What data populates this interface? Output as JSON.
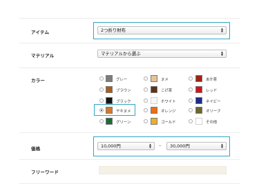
{
  "form": {
    "item": {
      "label": "アイテム",
      "value": "2つ折り財布",
      "arrows": "▲▼"
    },
    "material": {
      "label": "マテリアル",
      "value": "マテリアルから選ぶ",
      "arrows": "▲▼"
    },
    "color": {
      "label": "カラー",
      "selected": "ヤキヌメ",
      "options": [
        {
          "name": "グレー",
          "color": "#7d7d7d",
          "checked": false
        },
        {
          "name": "ブラウン",
          "color": "#a85d1c",
          "checked": false
        },
        {
          "name": "ブラック",
          "color": "#141414",
          "checked": false
        },
        {
          "name": "ヤキヌメ",
          "color": "#d6782a",
          "checked": true
        },
        {
          "name": "グリーン",
          "color": "#1d6b3a",
          "checked": false
        },
        {
          "name": "ヌメ",
          "color": "#e9c396",
          "checked": false
        },
        {
          "name": "こげ茶",
          "color": "#5d3415",
          "checked": false
        },
        {
          "name": "ホワイト",
          "color": "#f7f7f7",
          "checked": false
        },
        {
          "name": "オレンジ",
          "color": "#ee6d12",
          "checked": false
        },
        {
          "name": "ゴールド",
          "color": "#e8b12a",
          "checked": false
        },
        {
          "name": "あか茶",
          "color": "#9c2412",
          "checked": false
        },
        {
          "name": "レッド",
          "color": "#d7101a",
          "checked": false
        },
        {
          "name": "ネイビー",
          "color": "#1d2a88",
          "checked": false
        },
        {
          "name": "オリーブ",
          "color": "#6c6631",
          "checked": false
        },
        {
          "name": "その他",
          "color": "#ffffff",
          "checked": false
        }
      ]
    },
    "price": {
      "label": "価格",
      "min": "10,000円",
      "max": "30,000円",
      "separator": "–",
      "arrows": "▲▼"
    },
    "freeword": {
      "label": "フリーワード",
      "value": ""
    }
  },
  "colors": {
    "highlight": "#2ea6c0",
    "freeword_bg": "#f6f1e6"
  }
}
